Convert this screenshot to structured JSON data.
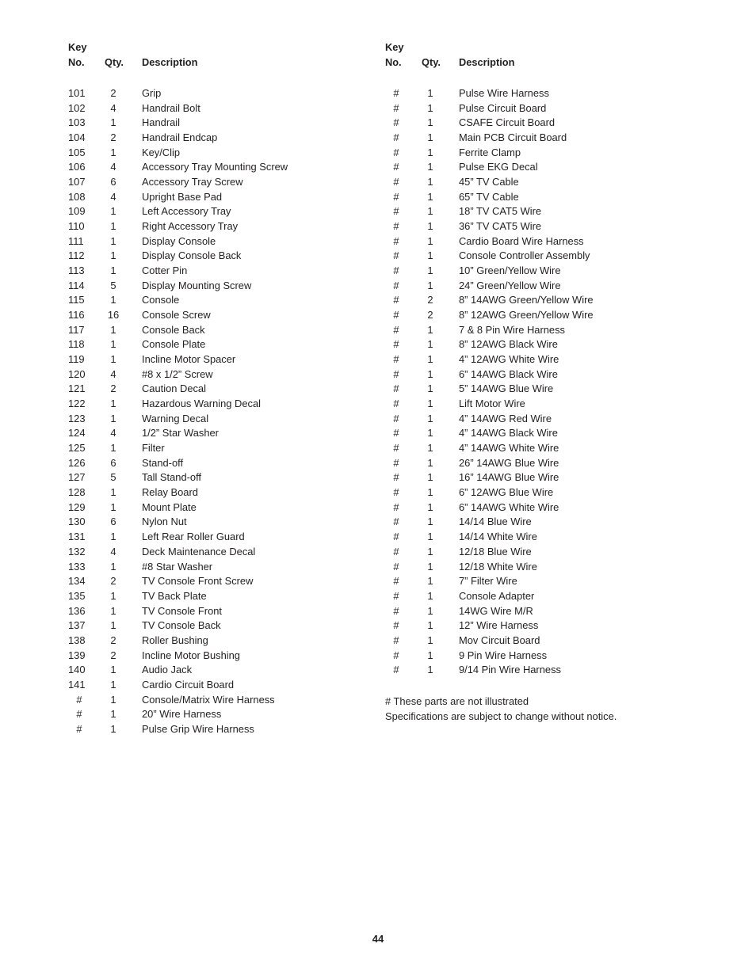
{
  "page": {
    "number": "44",
    "footnotes": [
      "# These parts are not illustrated",
      "Specifications are subject to change without notice."
    ]
  },
  "columns": [
    {
      "header": {
        "key": "Key",
        "no": "No.",
        "qty": "Qty.",
        "description": "Description"
      },
      "rows": [
        {
          "key": "101",
          "qty": "2",
          "desc": "Grip"
        },
        {
          "key": "102",
          "qty": "4",
          "desc": "Handrail Bolt"
        },
        {
          "key": "103",
          "qty": "1",
          "desc": "Handrail"
        },
        {
          "key": "104",
          "qty": "2",
          "desc": "Handrail Endcap"
        },
        {
          "key": "105",
          "qty": "1",
          "desc": "Key/Clip"
        },
        {
          "key": "106",
          "qty": "4",
          "desc": "Accessory Tray Mounting Screw"
        },
        {
          "key": "107",
          "qty": "6",
          "desc": "Accessory Tray Screw"
        },
        {
          "key": "108",
          "qty": "4",
          "desc": "Upright Base Pad"
        },
        {
          "key": "109",
          "qty": "1",
          "desc": "Left Accessory Tray"
        },
        {
          "key": "110",
          "qty": "1",
          "desc": "Right Accessory Tray"
        },
        {
          "key": "111",
          "qty": "1",
          "desc": "Display Console"
        },
        {
          "key": "112",
          "qty": "1",
          "desc": "Display Console Back"
        },
        {
          "key": "113",
          "qty": "1",
          "desc": "Cotter Pin"
        },
        {
          "key": "114",
          "qty": "5",
          "desc": "Display Mounting Screw"
        },
        {
          "key": "115",
          "qty": "1",
          "desc": "Console"
        },
        {
          "key": "116",
          "qty": "16",
          "desc": "Console Screw"
        },
        {
          "key": "117",
          "qty": "1",
          "desc": "Console Back"
        },
        {
          "key": "118",
          "qty": "1",
          "desc": "Console Plate"
        },
        {
          "key": "119",
          "qty": "1",
          "desc": "Incline Motor Spacer"
        },
        {
          "key": "120",
          "qty": "4",
          "desc": "#8 x 1/2” Screw"
        },
        {
          "key": "121",
          "qty": "2",
          "desc": "Caution Decal"
        },
        {
          "key": "122",
          "qty": "1",
          "desc": "Hazardous Warning Decal"
        },
        {
          "key": "123",
          "qty": "1",
          "desc": "Warning Decal"
        },
        {
          "key": "124",
          "qty": "4",
          "desc": "1/2” Star Washer"
        },
        {
          "key": "125",
          "qty": "1",
          "desc": "Filter"
        },
        {
          "key": "126",
          "qty": "6",
          "desc": "Stand-off"
        },
        {
          "key": "127",
          "qty": "5",
          "desc": "Tall Stand-off"
        },
        {
          "key": "128",
          "qty": "1",
          "desc": "Relay Board"
        },
        {
          "key": "129",
          "qty": "1",
          "desc": "Mount Plate"
        },
        {
          "key": "130",
          "qty": "6",
          "desc": "Nylon Nut"
        },
        {
          "key": "131",
          "qty": "1",
          "desc": "Left Rear Roller Guard"
        },
        {
          "key": "132",
          "qty": "4",
          "desc": "Deck Maintenance Decal"
        },
        {
          "key": "133",
          "qty": "1",
          "desc": "#8 Star Washer"
        },
        {
          "key": "134",
          "qty": "2",
          "desc": "TV Console Front Screw"
        },
        {
          "key": "135",
          "qty": "1",
          "desc": "TV Back Plate"
        },
        {
          "key": "136",
          "qty": "1",
          "desc": "TV Console Front"
        },
        {
          "key": "137",
          "qty": "1",
          "desc": "TV Console Back"
        },
        {
          "key": "138",
          "qty": "2",
          "desc": "Roller Bushing"
        },
        {
          "key": "139",
          "qty": "2",
          "desc": "Incline Motor Bushing"
        },
        {
          "key": "140",
          "qty": "1",
          "desc": "Audio Jack"
        },
        {
          "key": "141",
          "qty": "1",
          "desc": "Cardio Circuit Board"
        },
        {
          "key": "#",
          "qty": "1",
          "desc": "Console/Matrix Wire Harness"
        },
        {
          "key": "#",
          "qty": "1",
          "desc": "20” Wire Harness"
        },
        {
          "key": "#",
          "qty": "1",
          "desc": "Pulse Grip Wire Harness"
        }
      ]
    },
    {
      "header": {
        "key": "Key",
        "no": "No.",
        "qty": "Qty.",
        "description": "Description"
      },
      "rows": [
        {
          "key": "#",
          "qty": "1",
          "desc": "Pulse Wire Harness"
        },
        {
          "key": "#",
          "qty": "1",
          "desc": "Pulse Circuit Board"
        },
        {
          "key": "#",
          "qty": "1",
          "desc": "CSAFE Circuit Board"
        },
        {
          "key": "#",
          "qty": "1",
          "desc": "Main PCB Circuit Board"
        },
        {
          "key": "#",
          "qty": "1",
          "desc": "Ferrite Clamp"
        },
        {
          "key": "#",
          "qty": "1",
          "desc": "Pulse EKG Decal"
        },
        {
          "key": "#",
          "qty": "1",
          "desc": "45” TV Cable"
        },
        {
          "key": "#",
          "qty": "1",
          "desc": "65” TV Cable"
        },
        {
          "key": "#",
          "qty": "1",
          "desc": "18” TV CAT5 Wire"
        },
        {
          "key": "#",
          "qty": "1",
          "desc": "36” TV CAT5 Wire"
        },
        {
          "key": "#",
          "qty": "1",
          "desc": "Cardio Board Wire Harness"
        },
        {
          "key": "#",
          "qty": "1",
          "desc": "Console Controller Assembly"
        },
        {
          "key": "#",
          "qty": "1",
          "desc": "10” Green/Yellow Wire"
        },
        {
          "key": "#",
          "qty": "1",
          "desc": "24” Green/Yellow Wire"
        },
        {
          "key": "#",
          "qty": "2",
          "desc": "8” 14AWG Green/Yellow Wire"
        },
        {
          "key": "#",
          "qty": "2",
          "desc": "8” 12AWG Green/Yellow Wire"
        },
        {
          "key": "#",
          "qty": "1",
          "desc": "7 & 8 Pin Wire Harness"
        },
        {
          "key": "#",
          "qty": "1",
          "desc": "8” 12AWG Black Wire"
        },
        {
          "key": "#",
          "qty": "1",
          "desc": "4” 12AWG White Wire"
        },
        {
          "key": "#",
          "qty": "1",
          "desc": "6” 14AWG Black Wire"
        },
        {
          "key": "#",
          "qty": "1",
          "desc": "5” 14AWG Blue Wire"
        },
        {
          "key": "#",
          "qty": "1",
          "desc": "Lift Motor Wire"
        },
        {
          "key": "#",
          "qty": "1",
          "desc": "4” 14AWG Red Wire"
        },
        {
          "key": "#",
          "qty": "1",
          "desc": "4” 14AWG Black Wire"
        },
        {
          "key": "#",
          "qty": "1",
          "desc": "4” 14AWG White Wire"
        },
        {
          "key": "#",
          "qty": "1",
          "desc": "26” 14AWG Blue Wire"
        },
        {
          "key": "#",
          "qty": "1",
          "desc": "16” 14AWG Blue Wire"
        },
        {
          "key": "#",
          "qty": "1",
          "desc": "6” 12AWG Blue Wire"
        },
        {
          "key": "#",
          "qty": "1",
          "desc": "6” 14AWG White Wire"
        },
        {
          "key": "#",
          "qty": "1",
          "desc": "14/14 Blue Wire"
        },
        {
          "key": "#",
          "qty": "1",
          "desc": "14/14 White Wire"
        },
        {
          "key": "#",
          "qty": "1",
          "desc": "12/18 Blue Wire"
        },
        {
          "key": "#",
          "qty": "1",
          "desc": "12/18 White Wire"
        },
        {
          "key": "#",
          "qty": "1",
          "desc": "7” Filter Wire"
        },
        {
          "key": "#",
          "qty": "1",
          "desc": "Console Adapter"
        },
        {
          "key": "#",
          "qty": "1",
          "desc": "14WG Wire M/R"
        },
        {
          "key": "#",
          "qty": "1",
          "desc": "12” Wire Harness"
        },
        {
          "key": "#",
          "qty": "1",
          "desc": "Mov Circuit Board"
        },
        {
          "key": "#",
          "qty": "1",
          "desc": "9 Pin Wire Harness"
        },
        {
          "key": "#",
          "qty": "1",
          "desc": "9/14 Pin Wire Harness"
        }
      ]
    }
  ]
}
